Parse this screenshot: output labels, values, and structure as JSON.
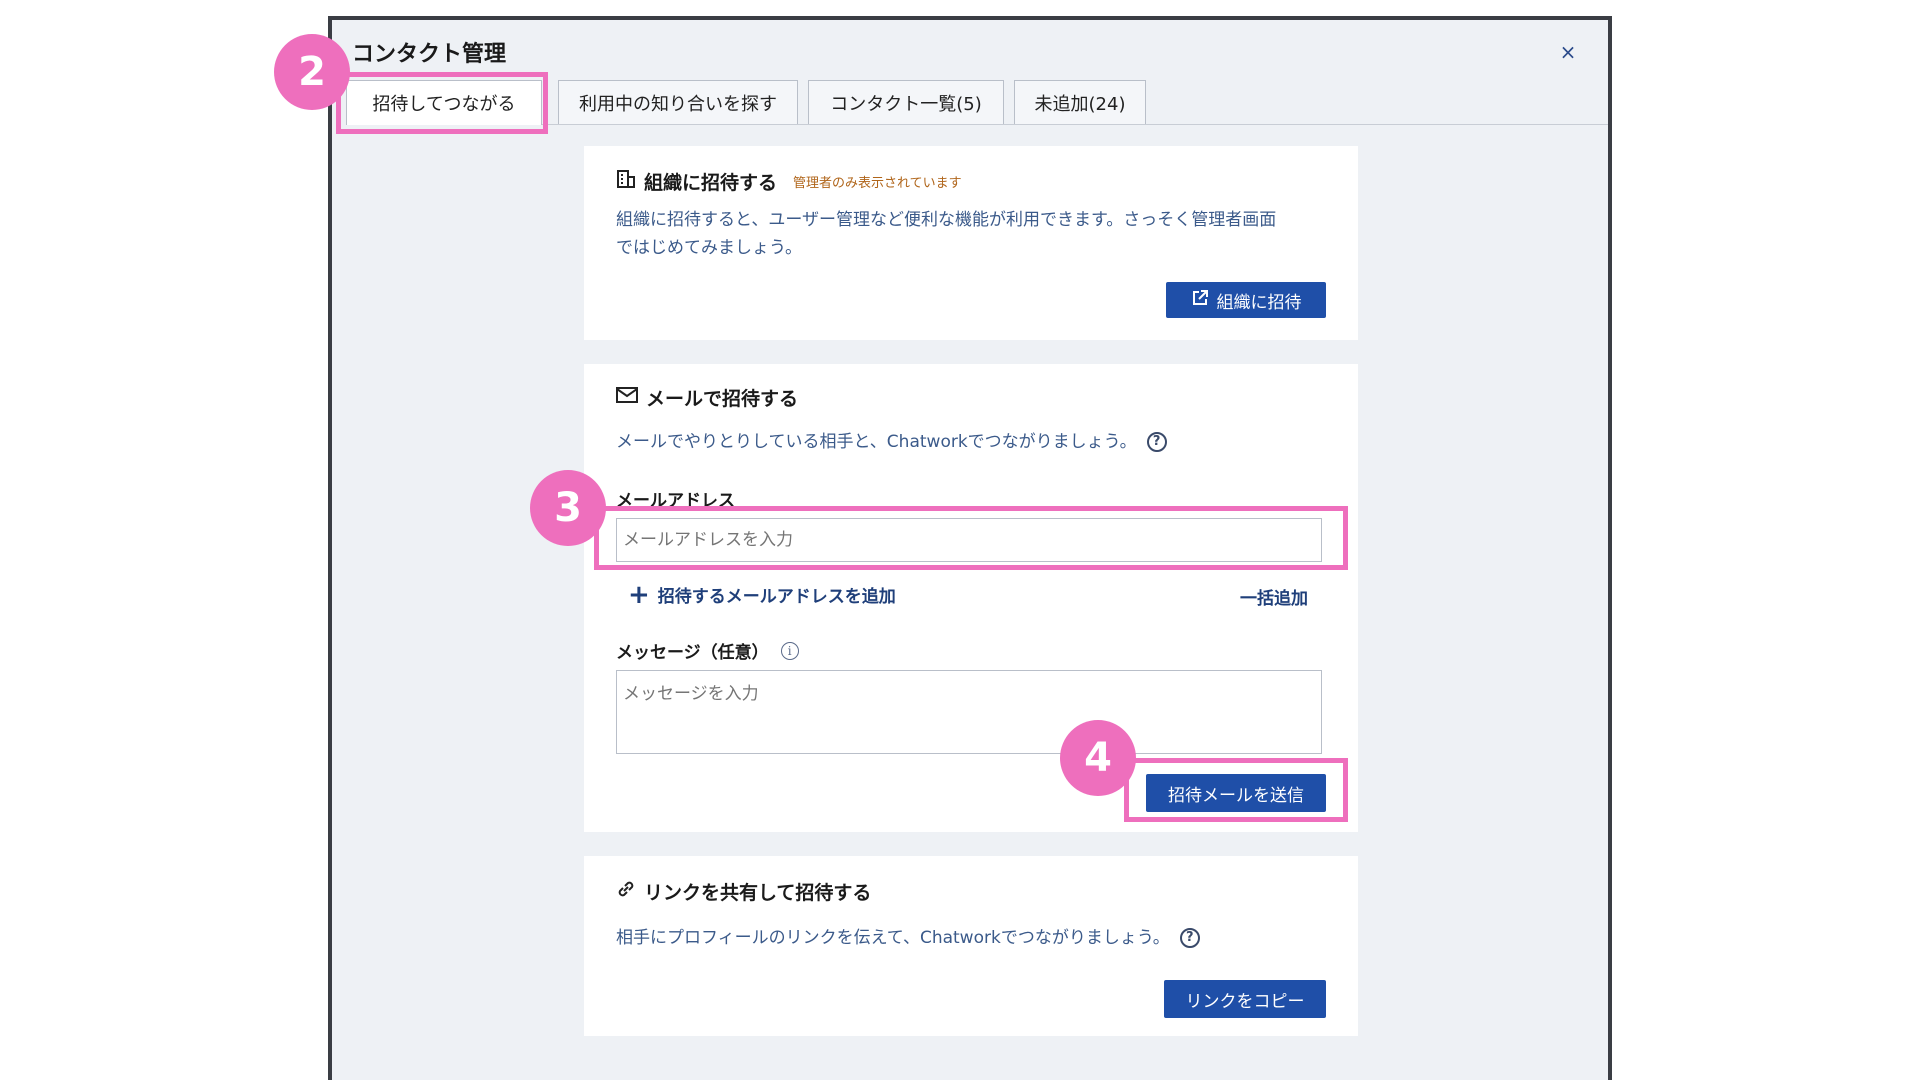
{
  "dialog": {
    "title": "コンタクト管理",
    "close_icon": "×"
  },
  "tabs": [
    {
      "label": "招待してつながる",
      "active": true
    },
    {
      "label": "利用中の知り合いを探す",
      "active": false
    },
    {
      "label": "コンタクト一覧(5)",
      "active": false
    },
    {
      "label": "未追加(24)",
      "active": false
    }
  ],
  "org_invite": {
    "icon": "building-icon",
    "heading": "組織に招待する",
    "admin_note": "管理者のみ表示されています",
    "description_line1": "組織に招待すると、ユーザー管理など便利な機能が利用できます。さっそく管理者画面",
    "description_line2": "ではじめてみましょう。",
    "button_label": "組織に招待"
  },
  "email_invite": {
    "icon": "mail-icon",
    "heading": "メールで招待する",
    "description": "メールでやりとりしている相手と、Chatworkでつながりましょう。",
    "help_icon": "?",
    "email_label": "メールアドレス",
    "email_placeholder": "メールアドレスを入力",
    "add_email_label": "招待するメールアドレスを追加",
    "bulk_add_label": "一括追加",
    "message_label": "メッセージ（任意）",
    "info_icon": "i",
    "message_placeholder": "メッセージを入力",
    "send_button_label": "招待メールを送信"
  },
  "link_invite": {
    "icon": "link-icon",
    "heading": "リンクを共有して招待する",
    "description": "相手にプロフィールのリンクを伝えて、Chatworkでつながりましょう。",
    "help_icon": "?",
    "copy_button_label": "リンクをコピー"
  },
  "annotations": {
    "step2": "2",
    "step3": "3",
    "step4": "4",
    "highlight_color": "#ee6fbd"
  },
  "colors": {
    "primary_button": "#1f4fa8",
    "description_text": "#3b5a8a",
    "admin_note": "#b0651a"
  }
}
